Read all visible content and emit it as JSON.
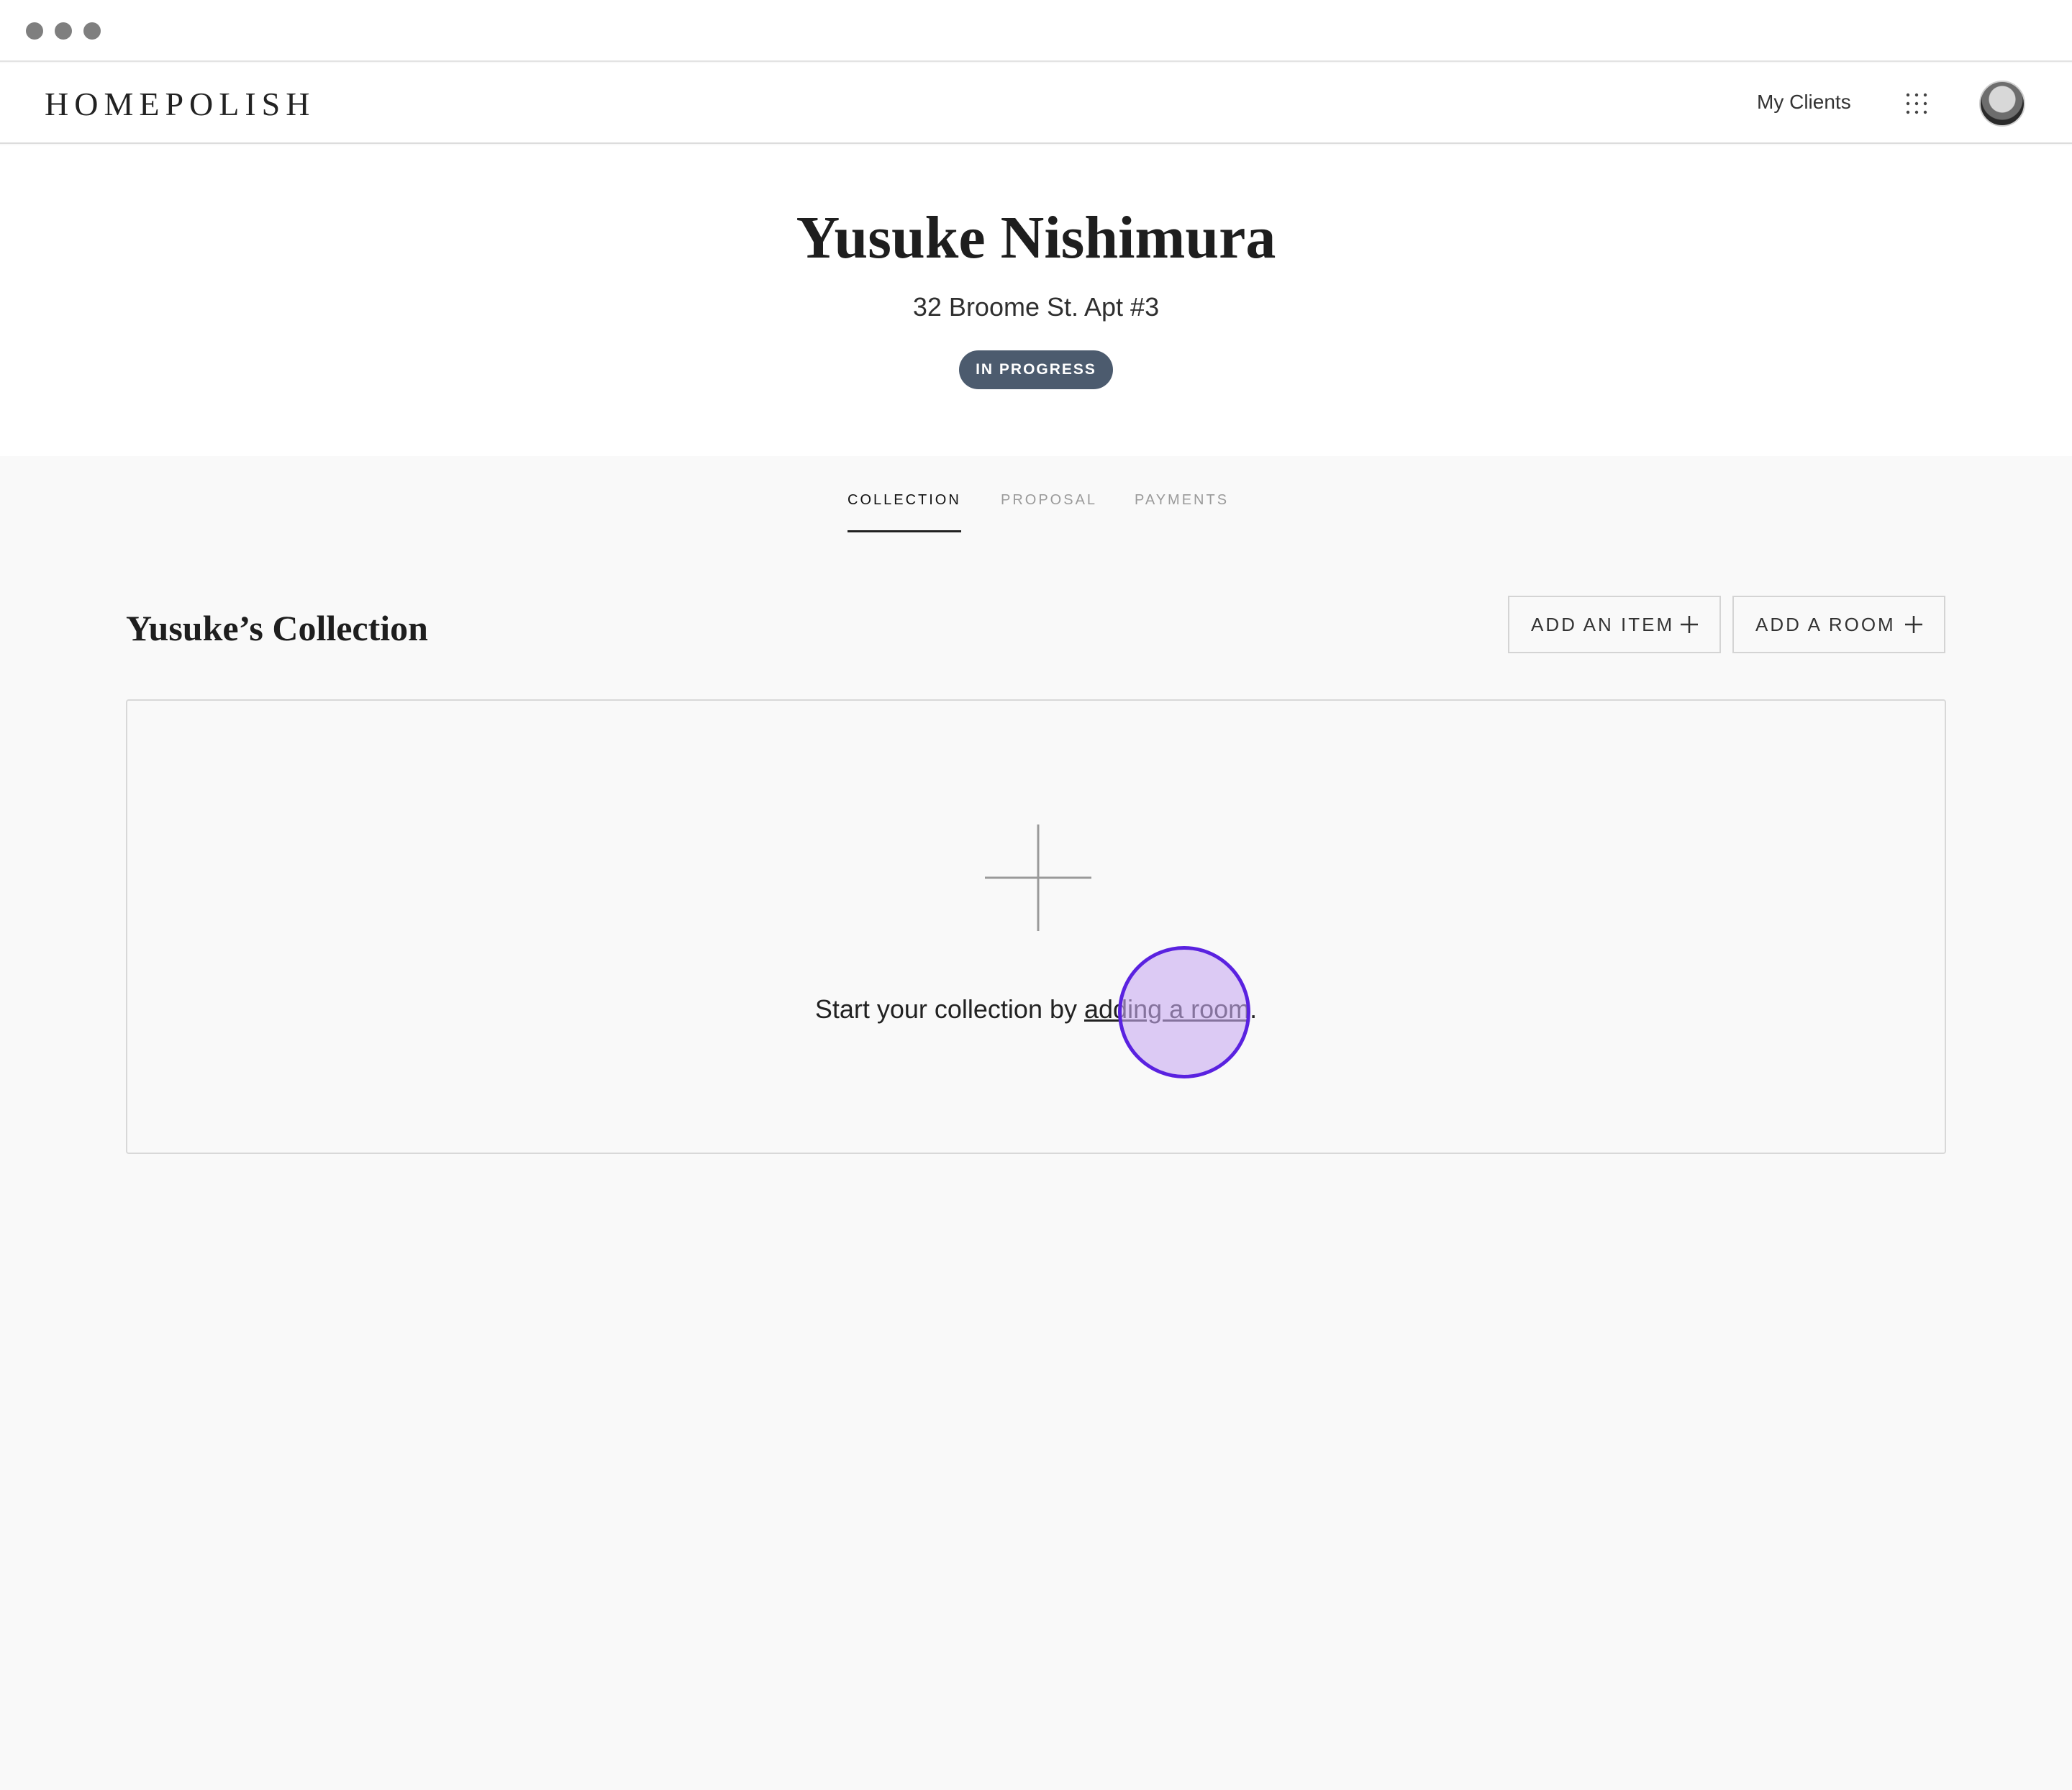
{
  "window": {
    "controls": [
      "close",
      "minimize",
      "maximize"
    ]
  },
  "header": {
    "logo": "HOMEPOLISH",
    "nav_link": "My Clients",
    "apps_icon": "grid-icon",
    "avatar_icon": "user-avatar"
  },
  "client": {
    "name": "Yusuke Nishimura",
    "address": "32 Broome St. Apt #3",
    "status": "IN PROGRESS",
    "status_color": "#4c5b6e"
  },
  "tabs": [
    {
      "label": "COLLECTION",
      "active": true
    },
    {
      "label": "PROPOSAL",
      "active": false
    },
    {
      "label": "PAYMENTS",
      "active": false
    }
  ],
  "collection": {
    "title": "Yusuke’s Collection",
    "add_item_label": "ADD AN ITEM",
    "add_room_label": "ADD A ROOM",
    "empty_text_prefix": "Start your collection by ",
    "empty_link": "adding a room",
    "empty_text_suffix": "."
  },
  "colors": {
    "cursor_ring": "#5a22e0",
    "cursor_fill": "#d9c6f5",
    "page_background": "#f9f9f9"
  }
}
